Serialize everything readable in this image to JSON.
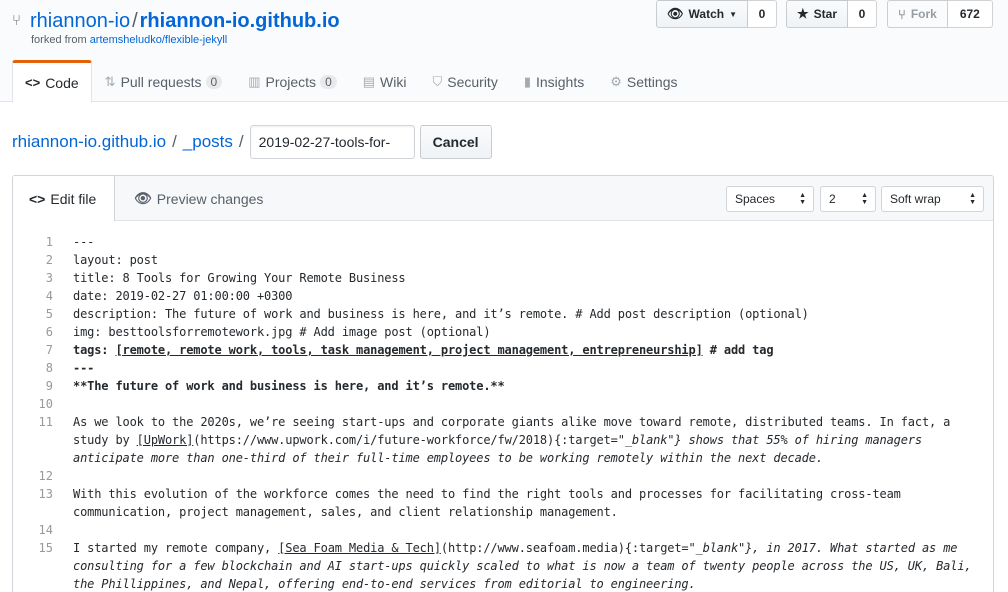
{
  "repo": {
    "owner": "rhiannon-io",
    "name": "rhiannon-io.github.io",
    "forked_prefix": "forked from ",
    "forked_from": "artemsheludko/flexible-jekyll"
  },
  "actions": {
    "watch_label": "Watch",
    "watch_count": "0",
    "star_label": "Star",
    "star_count": "0",
    "fork_label": "Fork",
    "fork_count": "672"
  },
  "nav": {
    "code": "Code",
    "pulls": "Pull requests",
    "pulls_count": "0",
    "projects": "Projects",
    "projects_count": "0",
    "wiki": "Wiki",
    "security": "Security",
    "insights": "Insights",
    "settings": "Settings"
  },
  "breadcrumb": {
    "repo": "rhiannon-io.github.io",
    "sep1": "/",
    "folder": "_posts",
    "sep2": "/",
    "filename": "2019-02-27-tools-for-",
    "cancel": "Cancel"
  },
  "editor_header": {
    "edit_tab": "Edit file",
    "preview_tab": "Preview changes",
    "indent_mode": "Spaces",
    "indent_size": "2",
    "wrap_mode": "Soft wrap"
  },
  "lines": [
    {
      "n": "1",
      "text": "---"
    },
    {
      "n": "2",
      "text": "layout: post"
    },
    {
      "n": "3",
      "text": "title: 8 Tools for Growing Your Remote Business"
    },
    {
      "n": "4",
      "text": "date: 2019-02-27 01:00:00 +0300"
    },
    {
      "n": "5",
      "text": "description: The future of work and business is here, and it’s remote. # Add post description (optional)"
    },
    {
      "n": "6",
      "text": "img: besttoolsforremotework.jpg # Add image post (optional)"
    },
    {
      "n": "7a",
      "text": "tags: "
    },
    {
      "n": "7b",
      "text": "[remote, remote work, tools, task management, project management, entrepreneurship]"
    },
    {
      "n": "7c",
      "text": " # add tag"
    },
    {
      "n": "8",
      "text": "---"
    },
    {
      "n": "9",
      "text": "**The future of work and business is here, and it’s remote.**"
    },
    {
      "n": "10",
      "text": ""
    },
    {
      "n": "11a",
      "text": "As we look to the 2020s, we’re seeing start-ups and corporate giants alike move toward remote, distributed teams. In fact, a study by "
    },
    {
      "n": "11b",
      "text": "[UpWork]"
    },
    {
      "n": "11c",
      "text": "(https://www.upwork.com/i/future-workforce/fw/2018){:target=\""
    },
    {
      "n": "11d",
      "text": "_blank\"} shows that 55% of hiring managers anticipate more than one-third of their full-time employees to be working remotely within the next decade."
    },
    {
      "n": "12",
      "text": ""
    },
    {
      "n": "13",
      "text": "With this evolution of the workforce comes the need to find the right tools and processes for facilitating cross-team communication, project management, sales, and client relationship management."
    },
    {
      "n": "14",
      "text": ""
    },
    {
      "n": "15a",
      "text": "I started my remote company, "
    },
    {
      "n": "15b",
      "text": "[Sea Foam Media & Tech]"
    },
    {
      "n": "15c",
      "text": "(http://www.seafoam.media){:target=\""
    },
    {
      "n": "15d",
      "text": "_blank\"}, in 2017. What started as me consulting for a few blockchain and AI start-ups quickly scaled to what is now a team of twenty people across the US, UK, Bali, the Phillippines, and Nepal, offering end-to-end services from editorial to engineering."
    }
  ],
  "line_numbers": [
    "1",
    "2",
    "3",
    "4",
    "5",
    "6",
    "7",
    "8",
    "9",
    "10",
    "11",
    "12",
    "13",
    "14",
    "15"
  ]
}
